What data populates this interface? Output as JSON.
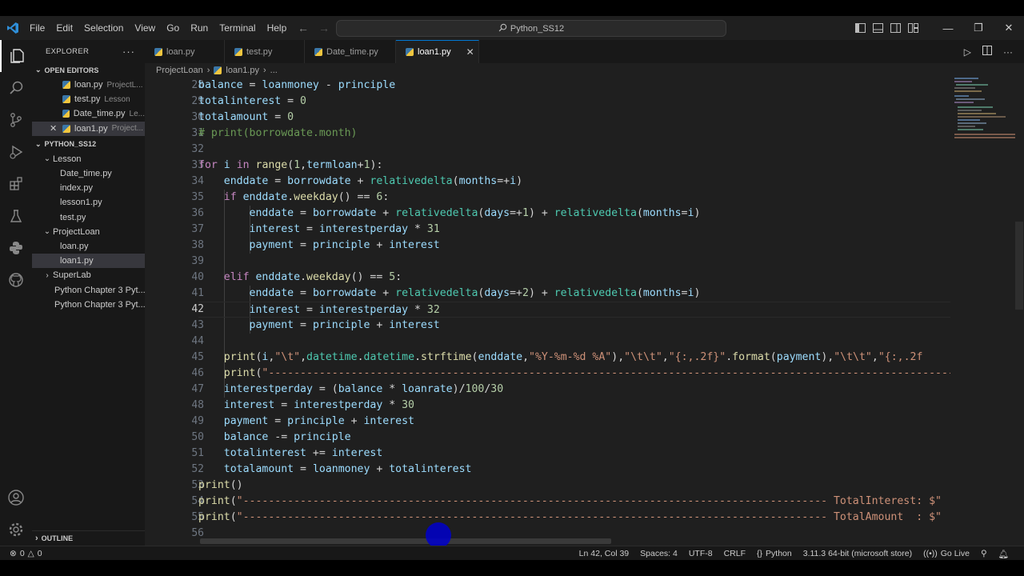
{
  "colors": {
    "accent": "#0078d4",
    "editor_bg": "#1f1f1f",
    "sidebar_bg": "#181818"
  },
  "menu": [
    "File",
    "Edit",
    "Selection",
    "View",
    "Go",
    "Run",
    "Terminal",
    "Help"
  ],
  "command_center": {
    "label": "Python_SS12",
    "icon": "search-icon"
  },
  "sidebar": {
    "title": "EXPLORER",
    "open_editors_title": "OPEN EDITORS",
    "open_editors": [
      {
        "name": "loan.py",
        "desc": "ProjectL..."
      },
      {
        "name": "test.py",
        "desc": "Lesson"
      },
      {
        "name": "Date_time.py",
        "desc": "Le..."
      },
      {
        "name": "loan1.py",
        "desc": "Project..."
      }
    ],
    "workspace_title": "PYTHON_SS12",
    "tree": {
      "lesson_folder": "Lesson",
      "lesson_files": [
        "Date_time.py",
        "index.py",
        "lesson1.py",
        "test.py"
      ],
      "projectloan_folder": "ProjectLoan",
      "projectloan_files": [
        "loan.py",
        "loan1.py"
      ],
      "superlab_folder": "SuperLab",
      "chapter_files": [
        "Python Chapter 3 Pyt...",
        "Python Chapter 3 Pyt..."
      ]
    },
    "outline_title": "OUTLINE"
  },
  "tabs": [
    "loan.py",
    "test.py",
    "Date_time.py",
    "loan1.py"
  ],
  "breadcrumb": {
    "folder": "ProjectLoan",
    "file": "loan1.py",
    "more": "..."
  },
  "editor": {
    "line_numbers": [
      "28",
      "29",
      "30",
      "31",
      "32",
      "33",
      "34",
      "35",
      "36",
      "37",
      "38",
      "39",
      "40",
      "41",
      "42",
      "43",
      "44",
      "45",
      "46",
      "47",
      "48",
      "49",
      "50",
      "51",
      "52",
      "53",
      "54",
      "55",
      "56"
    ],
    "current_line": "42"
  },
  "status": {
    "errors": "0",
    "warnings": "0",
    "position": "Ln 42, Col 39",
    "spaces": "Spaces: 4",
    "encoding": "UTF-8",
    "eol": "CRLF",
    "language": "Python",
    "interpreter": "3.11.3 64-bit (microsoft store)",
    "go_live": "Go Live"
  }
}
